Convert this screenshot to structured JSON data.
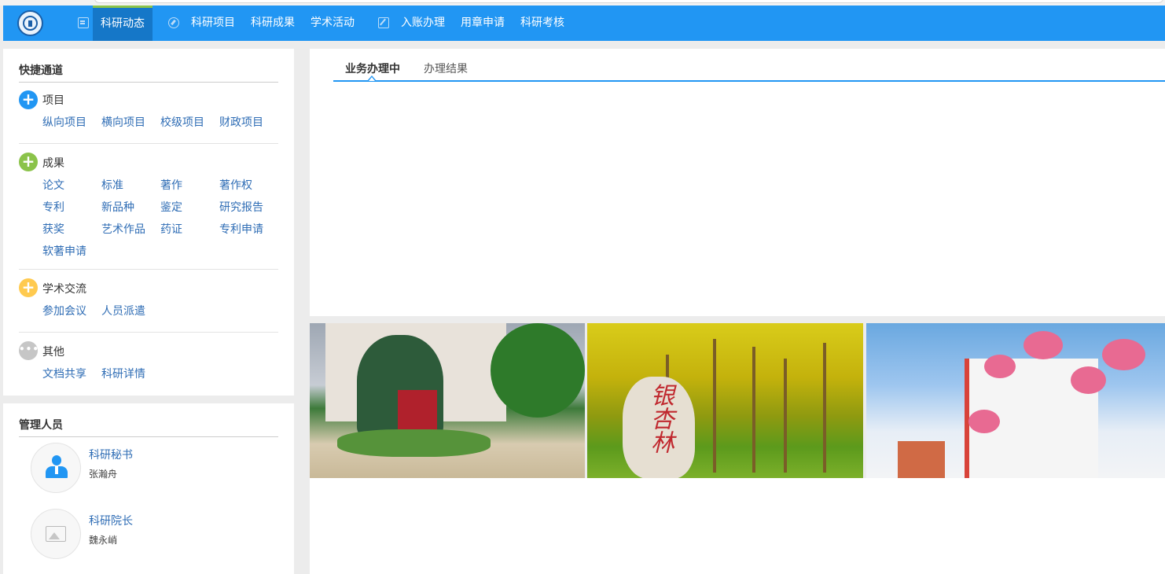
{
  "nav": {
    "items": [
      {
        "label": "科研动态",
        "icon": "document-icon",
        "active": true
      },
      {
        "label": "科研项目",
        "icon": "compass-icon"
      },
      {
        "label": "科研成果"
      },
      {
        "label": "学术活动"
      },
      {
        "label": "入账办理",
        "icon": "edit-icon"
      },
      {
        "label": "用章申请"
      },
      {
        "label": "科研考核"
      }
    ],
    "accent": "#2196f3",
    "active_bg": "#1577c8",
    "active_top": "#8bc34a"
  },
  "quick": {
    "title": "快捷通道",
    "categories": [
      {
        "label": "项目",
        "icon": "plus-circle-blue-icon",
        "links": [
          "纵向项目",
          "横向项目",
          "校级项目",
          "财政项目"
        ]
      },
      {
        "label": "成果",
        "icon": "plus-circle-green-icon",
        "links": [
          "论文",
          "标准",
          "著作",
          "著作权",
          "专利",
          "新品种",
          "鉴定",
          "研究报告",
          "获奖",
          "艺术作品",
          "药证",
          "专利申请",
          "软著申请"
        ]
      },
      {
        "label": "学术交流",
        "icon": "plus-circle-yellow-icon",
        "links": [
          "参加会议",
          "人员派遣"
        ]
      },
      {
        "label": "其他",
        "icon": "more-circle-gray-icon",
        "links": [
          "文档共享",
          "科研详情"
        ]
      }
    ]
  },
  "managers": {
    "title": "管理人员",
    "people": [
      {
        "role": "科研秘书",
        "name": "张瀚舟",
        "avatar": "person-icon"
      },
      {
        "role": "科研院长",
        "name": "魏永峭",
        "avatar": "image-placeholder-icon"
      }
    ]
  },
  "main": {
    "tabs": [
      {
        "label": "业务办理中",
        "active": true
      },
      {
        "label": "办理结果"
      }
    ]
  },
  "photos": {
    "caption_stone": "银杏林"
  }
}
